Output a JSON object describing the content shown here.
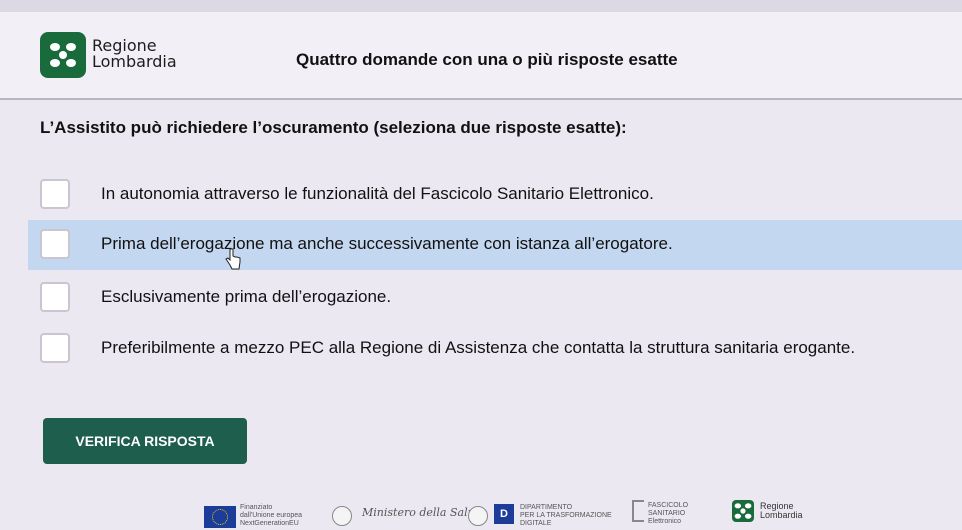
{
  "header": {
    "logo_text_line1": "Regione",
    "logo_text_line2": "Lombardia",
    "title": "Quattro domande con una o più risposte esatte"
  },
  "question": "L’Assistito può richiedere l’oscuramento (seleziona due risposte esatte):",
  "options": [
    {
      "label": "In autonomia attraverso le funzionalità del Fascicolo Sanitario Elettronico.",
      "checked": false
    },
    {
      "label": "Prima dell’erogazione ma anche successivamente con istanza all’erogatore.",
      "checked": false,
      "hovered": true
    },
    {
      "label": "Esclusivamente prima dell’erogazione.",
      "checked": false
    },
    {
      "label": "Preferibilmente a mezzo PEC alla Regione di Assistenza che contatta la struttura sanitaria erogante.",
      "checked": false
    }
  ],
  "verify_label": "VERIFICA RISPOSTA",
  "footer": {
    "eu_line1": "Finanziato",
    "eu_line2": "dall'Unione europea",
    "eu_line3": "NextGenerationEU",
    "ministry": "Ministero della Salute",
    "dept_line1": "DIPARTIMENTO",
    "dept_line2": "PER LA TRASFORMAZIONE",
    "dept_line3": "DIGITALE",
    "fse_line1": "FASCICOLO",
    "fse_line2": "SANITARIO",
    "fse_line3": "Elettronico",
    "rl_line1": "Regione",
    "rl_line2": "Lombardia"
  },
  "colors": {
    "accent": "#1d5e4c",
    "highlight": "#c4d7f0",
    "logo_green": "#1a6b3c"
  }
}
